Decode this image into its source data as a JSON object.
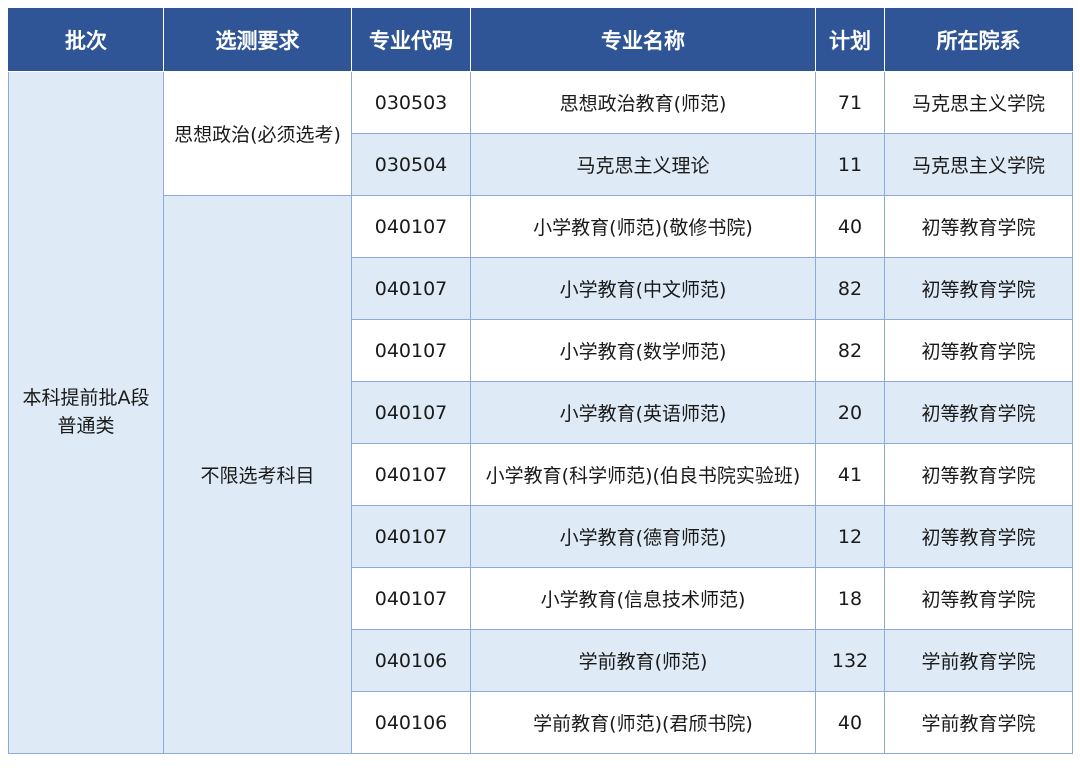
{
  "table": {
    "headers": [
      "批次",
      "选测要求",
      "专业代码",
      "专业名称",
      "计划",
      "所在院系"
    ],
    "batch": {
      "line1": "本科提前批A段",
      "line2": "普通类"
    },
    "requirements": [
      "思想政治(必须选考)",
      "不限选考科目"
    ],
    "rows": [
      {
        "code": "030503",
        "name": "思想政治教育(师范)",
        "plan": "71",
        "dept": "马克思主义学院"
      },
      {
        "code": "030504",
        "name": "马克思主义理论",
        "plan": "11",
        "dept": "马克思主义学院"
      },
      {
        "code": "040107",
        "name": "小学教育(师范)(敬修书院)",
        "plan": "40",
        "dept": "初等教育学院"
      },
      {
        "code": "040107",
        "name": "小学教育(中文师范)",
        "plan": "82",
        "dept": "初等教育学院"
      },
      {
        "code": "040107",
        "name": "小学教育(数学师范)",
        "plan": "82",
        "dept": "初等教育学院"
      },
      {
        "code": "040107",
        "name": "小学教育(英语师范)",
        "plan": "20",
        "dept": "初等教育学院"
      },
      {
        "code": "040107",
        "name": "小学教育(科学师范)(伯良书院实验班)",
        "plan": "41",
        "dept": "初等教育学院"
      },
      {
        "code": "040107",
        "name": "小学教育(德育师范)",
        "plan": "12",
        "dept": "初等教育学院"
      },
      {
        "code": "040107",
        "name": "小学教育(信息技术师范)",
        "plan": "18",
        "dept": "初等教育学院"
      },
      {
        "code": "040106",
        "name": "学前教育(师范)",
        "plan": "132",
        "dept": "学前教育学院"
      },
      {
        "code": "040106",
        "name": "学前教育(师范)(君颀书院)",
        "plan": "40",
        "dept": "学前教育学院"
      }
    ]
  },
  "colors": {
    "header_bg": "#2f5597",
    "header_text": "#ffffff",
    "stripe_bg": "#deeaf6",
    "border": "#8eaadb"
  }
}
